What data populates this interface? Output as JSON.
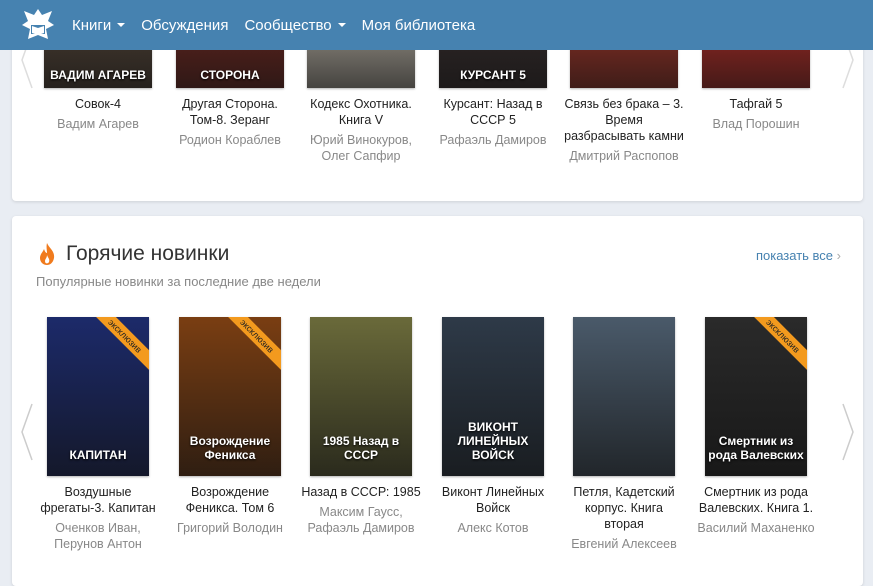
{
  "header": {
    "nav": [
      {
        "label": "Книги",
        "dropdown": true
      },
      {
        "label": "Обсуждения"
      },
      {
        "label": "Сообщество",
        "dropdown": true
      },
      {
        "label": "Моя библиотека"
      }
    ]
  },
  "top_books": [
    {
      "title": "Совок-4",
      "author": "Вадим Агарев",
      "cover_text": "ВАДИМ АГАРЕВ",
      "color": "#5a4a3c"
    },
    {
      "title": "Другая Сторона. Том-8. Зеранг",
      "author": "Родион Кораблев",
      "cover_text": "СТОРОНА",
      "color": "#7a2a22"
    },
    {
      "title": "Кодекс Охотника. Книга V",
      "author": "Юрий Винокуров, Олег Сапфир",
      "cover_text": "",
      "color": "#c9c2b4"
    },
    {
      "title": "Курсант: Назад в СССР 5",
      "author": "Рафаэль Дамиров",
      "cover_text": "КУРСАНТ 5",
      "color": "#3a3030"
    },
    {
      "title": "Связь без брака – 3. Время разбрасывать камни",
      "author": "Дмитрий Распопов",
      "cover_text": "",
      "color": "#b33a2c"
    },
    {
      "title": "Тафгай 5",
      "author": "Влад Порошин",
      "cover_text": "",
      "color": "#c8312a"
    }
  ],
  "hot": {
    "title": "Горячие новинки",
    "subtitle": "Популярные новинки за последние две недели",
    "show_all": "показать все",
    "books": [
      {
        "title": "Воздушные фрегаты-3. Капитан",
        "author": "Оченков Иван, Перунов Антон",
        "cover_text": "КАПИТАН",
        "color": "#1c2a6a",
        "exclusive": "эксклюзив"
      },
      {
        "title": "Возрождение Феникса. Том 6",
        "author": "Григорий Володин",
        "cover_text": "Возрождение Феникса",
        "color": "#7a3e12",
        "exclusive": "эксклюзив"
      },
      {
        "title": "Назад в СССР: 1985",
        "author": "Максим Гаусс, Рафаэль Дамиров",
        "cover_text": "1985 Назад в СССР",
        "color": "#6a6a3a",
        "exclusive": ""
      },
      {
        "title": "Виконт Линейных Войск",
        "author": "Алекс Котов",
        "cover_text": "ВИКОНТ ЛИНЕЙНЫХ ВОЙСК",
        "color": "#2e3a48",
        "exclusive": ""
      },
      {
        "title": "Петля, Кадетский корпус. Книга вторая",
        "author": "Евгений Алексеев",
        "cover_text": "",
        "color": "#4a5a6a",
        "exclusive": ""
      },
      {
        "title": "Смертник из рода Валевских. Книга 1.",
        "author": "Василий Маханенко",
        "cover_text": "Смертник из рода Валевских",
        "color": "#2a2a2a",
        "exclusive": "эксклюзив"
      }
    ]
  }
}
